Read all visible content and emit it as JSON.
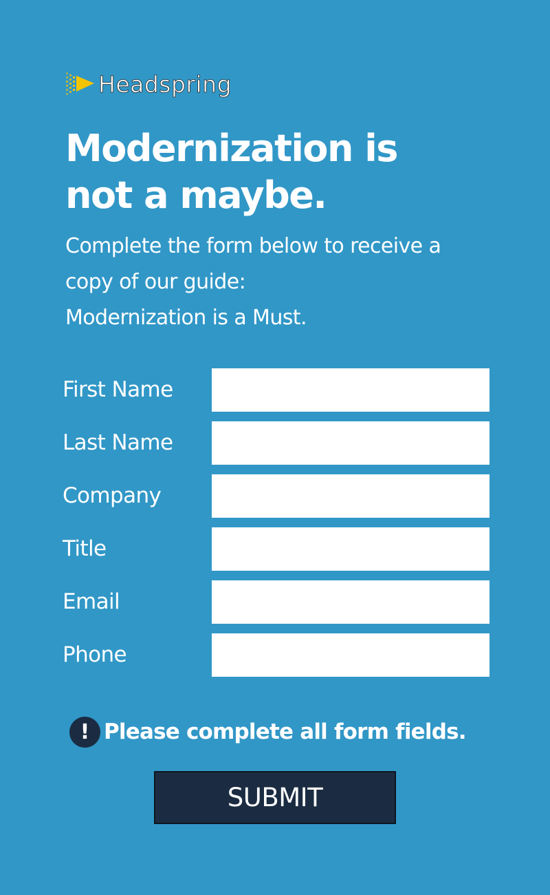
{
  "brand": {
    "name": "Headspring",
    "logo_icon": "headspring-logo-icon",
    "accent_color": "#f5c400"
  },
  "headline": {
    "line1": "Modernization is",
    "line2": "not a maybe."
  },
  "intro": {
    "line1": "Complete the form below to receive a",
    "line2": "copy of our guide:",
    "line3": "Modernization is a Must."
  },
  "form": {
    "fields": [
      {
        "label": "First Name",
        "value": "",
        "placeholder": ""
      },
      {
        "label": "Last Name",
        "value": "",
        "placeholder": ""
      },
      {
        "label": "Company",
        "value": "",
        "placeholder": ""
      },
      {
        "label": "Title",
        "value": "",
        "placeholder": ""
      },
      {
        "label": "Email",
        "value": "",
        "placeholder": ""
      },
      {
        "label": "Phone",
        "value": "",
        "placeholder": ""
      }
    ],
    "error": {
      "icon": "exclamation-icon",
      "symbol": "!",
      "message": "Please complete all form fields."
    },
    "submit_label": "SUBMIT"
  },
  "colors": {
    "background": "#3197c7",
    "button": "#1b2c42",
    "input": "#ffffff"
  }
}
